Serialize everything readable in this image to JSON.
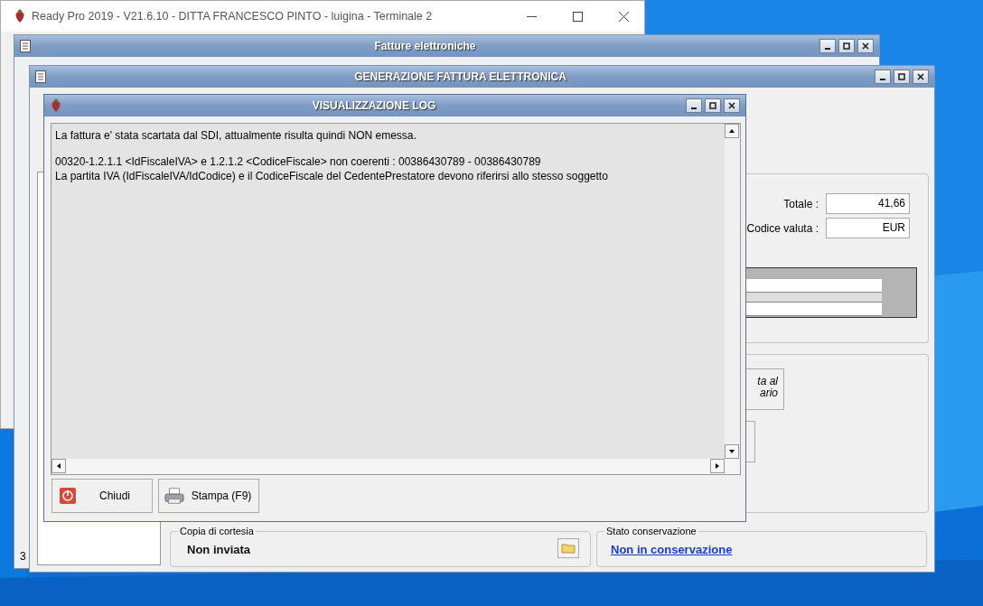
{
  "main_window": {
    "title": "Ready Pro 2019 - V21.6.10 - DITTA FRANCESCO PINTO - luigina - Terminale 2"
  },
  "invoices_window": {
    "title": "Fatture elettroniche",
    "status_fragment": "3"
  },
  "generation_window": {
    "title": "GENERAZIONE FATTURA ELETTRONICA",
    "totale": {
      "label": "Totale :",
      "value": "41,66"
    },
    "valuta": {
      "label": "Codice valuta :",
      "value": "EUR"
    },
    "send_button_fragment": [
      "ta al",
      "ario"
    ],
    "copia": {
      "legend": "Copia di cortesia",
      "value": "Non inviata"
    },
    "conservazione": {
      "legend": "Stato conservazione",
      "link": "Non in conservazione"
    }
  },
  "log_dialog": {
    "title": "VISUALIZZAZIONE LOG",
    "paragraphs": [
      [
        "La fattura e' stata scartata dal SDI, attualmente risulta quindi NON emessa."
      ],
      [
        "00320-1.2.1.1 <IdFiscaleIVA> e 1.2.1.2 <CodiceFiscale> non coerenti : 00386430789 - 00386430789",
        "La partita IVA (IdFiscaleIVA/IdCodice) e il CodiceFiscale del  CedentePrestatore devono riferirsi allo stesso soggetto"
      ]
    ],
    "buttons": [
      {
        "label": "Chiudi",
        "kind": "close"
      },
      {
        "label": "Stampa (F9)",
        "kind": "print"
      }
    ]
  }
}
